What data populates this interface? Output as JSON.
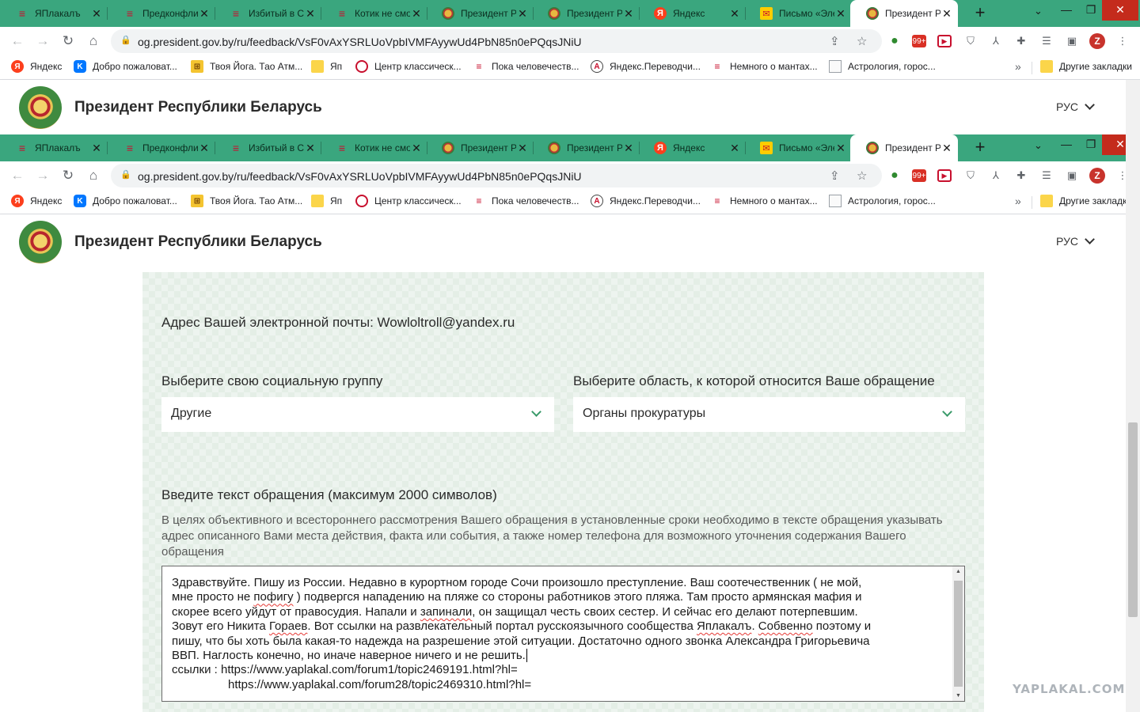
{
  "browser": {
    "tabs": [
      {
        "title": "ЯПлакалъ",
        "favicon": "yaplakal-icon"
      },
      {
        "title": "Предконфли",
        "favicon": "yaplakal-icon"
      },
      {
        "title": "Избитый в С",
        "favicon": "yaplakal-icon"
      },
      {
        "title": "Котик не смо",
        "favicon": "yaplakal-icon"
      },
      {
        "title": "Президент Р",
        "favicon": "emblem-icon"
      },
      {
        "title": "Президент Р",
        "favicon": "emblem-icon"
      },
      {
        "title": "Яндекс",
        "favicon": "yandex-icon"
      },
      {
        "title": "Письмо «Эле",
        "favicon": "mail-icon"
      },
      {
        "title": "Президент Р",
        "favicon": "emblem-icon",
        "active": true
      }
    ],
    "new_tab": "+",
    "url": "og.president.gov.by/ru/feedback/VsF0vAxYSRLUoVpbIVMFAyywUd4PbN85n0ePQqsJNiU",
    "profile_initial": "Z",
    "ext_badge": "99+",
    "bookmarks": [
      {
        "label": "Яндекс",
        "icon": "yandex-icon"
      },
      {
        "label": "Добро пожаловат...",
        "icon": "vk-icon"
      },
      {
        "label": "Твоя Йога. Тао Атм...",
        "icon": "yoga-icon"
      },
      {
        "label": "Яп",
        "icon": "folder-icon"
      },
      {
        "label": "Центр классическ...",
        "icon": "center-icon"
      },
      {
        "label": "Пока человечеств...",
        "icon": "yaplakal-icon"
      },
      {
        "label": "Яндекс.Переводчи...",
        "icon": "translator-icon"
      },
      {
        "label": "Немного о мантах...",
        "icon": "yaplakal-icon"
      },
      {
        "label": "Астрология, горос...",
        "icon": "page-icon"
      }
    ],
    "more": "»",
    "other_bookmarks": "Другие закладки"
  },
  "site": {
    "title": "Президент Республики Беларусь",
    "lang": "РУС"
  },
  "form": {
    "email_line": "Адрес Вашей электронной почты: Wowloltroll@yandex.ru",
    "social_group_label": "Выберите свою социальную группу",
    "social_group_value": "Другие",
    "area_label": "Выберите область, к которой относится Ваше обращение",
    "area_value": "Органы прокуратуры",
    "text_label": "Введите текст обращения (максимум 2000 символов)",
    "hint": "В целях объективного и всестороннего рассмотрения Вашего обращения в установленные сроки необходимо в тексте обращения указывать адрес описанного Вами места действия, факта или события, а также номер телефона для возможного уточнения содержания Вашего обращения",
    "message": {
      "l1": "Здравствуйте. Пишу из России. Недавно в курортном городе Сочи произошло преступление. Ваш соотечественник ( не мой,",
      "l2a": "мне просто не ",
      "l2b": "пофигу",
      "l2c": " ) подвергся нападению на пляже со стороны работников этого пляжа. Там просто армянская мафия и",
      "l3a": "скорее всего уйдут от правосудия. Напали и ",
      "l3b": "запинали",
      "l3c": ", он защищал честь своих сестер. И сейчас его делают потерпевшим.",
      "l4a": "Зовут его Никита ",
      "l4b": "Гораев",
      "l4c": ".  Вот ссылки на развлекательный портал русскоязычного сообщества ",
      "l4d": "Яплакалъ",
      "l4e": ". ",
      "l4f": "Собвенно",
      "l4g": " поэтому и",
      "l5": "пишу, что бы хоть была какая-то надежда на разрешение этой ситуации.  Достаточно одного звонка Александра Григорьевича",
      "l6": "ВВП. Наглость конечно, но иначе наверное ничего и не решить.",
      "l7": "ссылки : https://www.yaplakal.com/forum1/topic2469191.html?hl=",
      "l8": "https://www.yaplakal.com/forum28/topic2469310.html?hl="
    }
  },
  "watermark": "YAPLAKAL.COM",
  "colors": {
    "tabstrip": "#3aa67e",
    "form_bg": "#e4eee6",
    "accent": "#3a9a6a"
  }
}
